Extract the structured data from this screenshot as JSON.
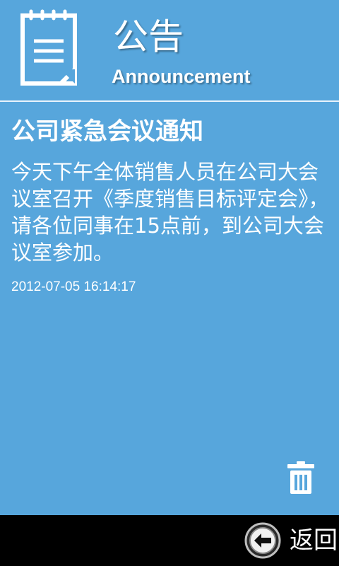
{
  "header": {
    "title_cn": "公告",
    "title_en": "Announcement",
    "icon": "notepad-icon"
  },
  "notice": {
    "title": "公司紧急会议通知",
    "body": "今天下午全体销售人员在公司大会议室召开《季度销售目标评定会》，请各位同事在15点前，到公司大会议室参加。",
    "time": "2012-07-05 16:14:17"
  },
  "actions": {
    "delete_icon": "trash-icon"
  },
  "bottom_bar": {
    "back_label": "返回",
    "back_icon": "back-arrow-icon"
  },
  "colors": {
    "background": "#57a6dc",
    "text": "#ffffff",
    "bottom_bar": "#000000"
  }
}
